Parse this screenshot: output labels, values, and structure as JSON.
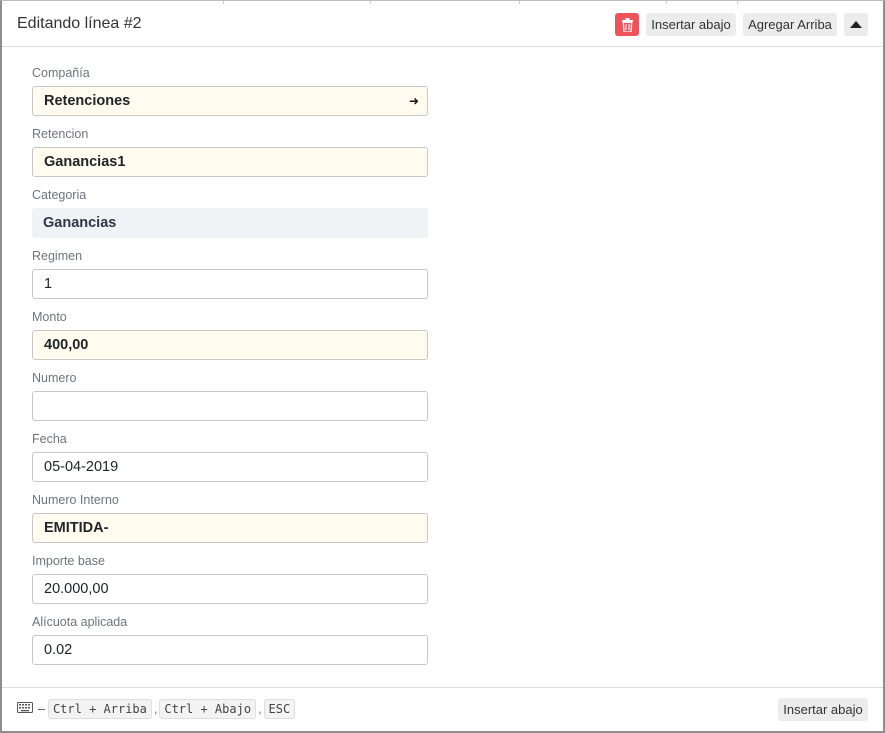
{
  "header": {
    "title": "Editando línea #2",
    "delete_icon": "trash-icon",
    "insert_below_label": "Insertar abajo",
    "add_above_label": "Agregar Arriba",
    "collapse_icon": "caret-up-icon"
  },
  "form": {
    "fields": [
      {
        "label": "Compañía",
        "value": "Retenciones",
        "style": "required",
        "has_arrow": true
      },
      {
        "label": "Retencion",
        "value": "Ganancias1",
        "style": "required"
      },
      {
        "label": "Categoria",
        "value": "Ganancias",
        "style": "readonly"
      },
      {
        "label": "Regimen",
        "value": "1",
        "style": "normal"
      },
      {
        "label": "Monto",
        "value": "400,00",
        "style": "required"
      },
      {
        "label": "Numero",
        "value": "",
        "style": "normal"
      },
      {
        "label": "Fecha",
        "value": "05-04-2019",
        "style": "normal"
      },
      {
        "label": "Numero Interno",
        "value": "EMITIDA-",
        "style": "required"
      },
      {
        "label": "Importe base",
        "value": "20.000,00",
        "style": "normal"
      },
      {
        "label": "Alícuota aplicada",
        "value": "0.02",
        "style": "normal"
      }
    ]
  },
  "footer": {
    "keyboard_icon": "keyboard-icon",
    "dash": "–",
    "shortcuts": [
      "Ctrl + Arriba",
      "Ctrl + Abajo",
      "ESC"
    ],
    "separator": ",",
    "insert_below_label": "Insertar abajo"
  },
  "colors": {
    "delete_button": "#f0525a",
    "required_field_bg": "#fffcef",
    "readonly_field_bg": "#f0f3f6"
  }
}
